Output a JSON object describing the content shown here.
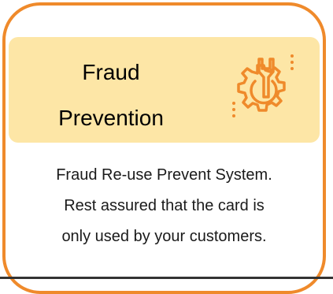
{
  "card": {
    "title_line1": "Fraud",
    "title_line2": "Prevention",
    "icon": "gear-wrench-icon",
    "description_line1": "Fraud Re-use Prevent System.",
    "description_line2": "Rest assured that the card is",
    "description_line3": "only used by your customers."
  },
  "colors": {
    "border": "#ef8a2b",
    "header_background": "#fde6a6",
    "icon_stroke": "#ef8a2b"
  }
}
